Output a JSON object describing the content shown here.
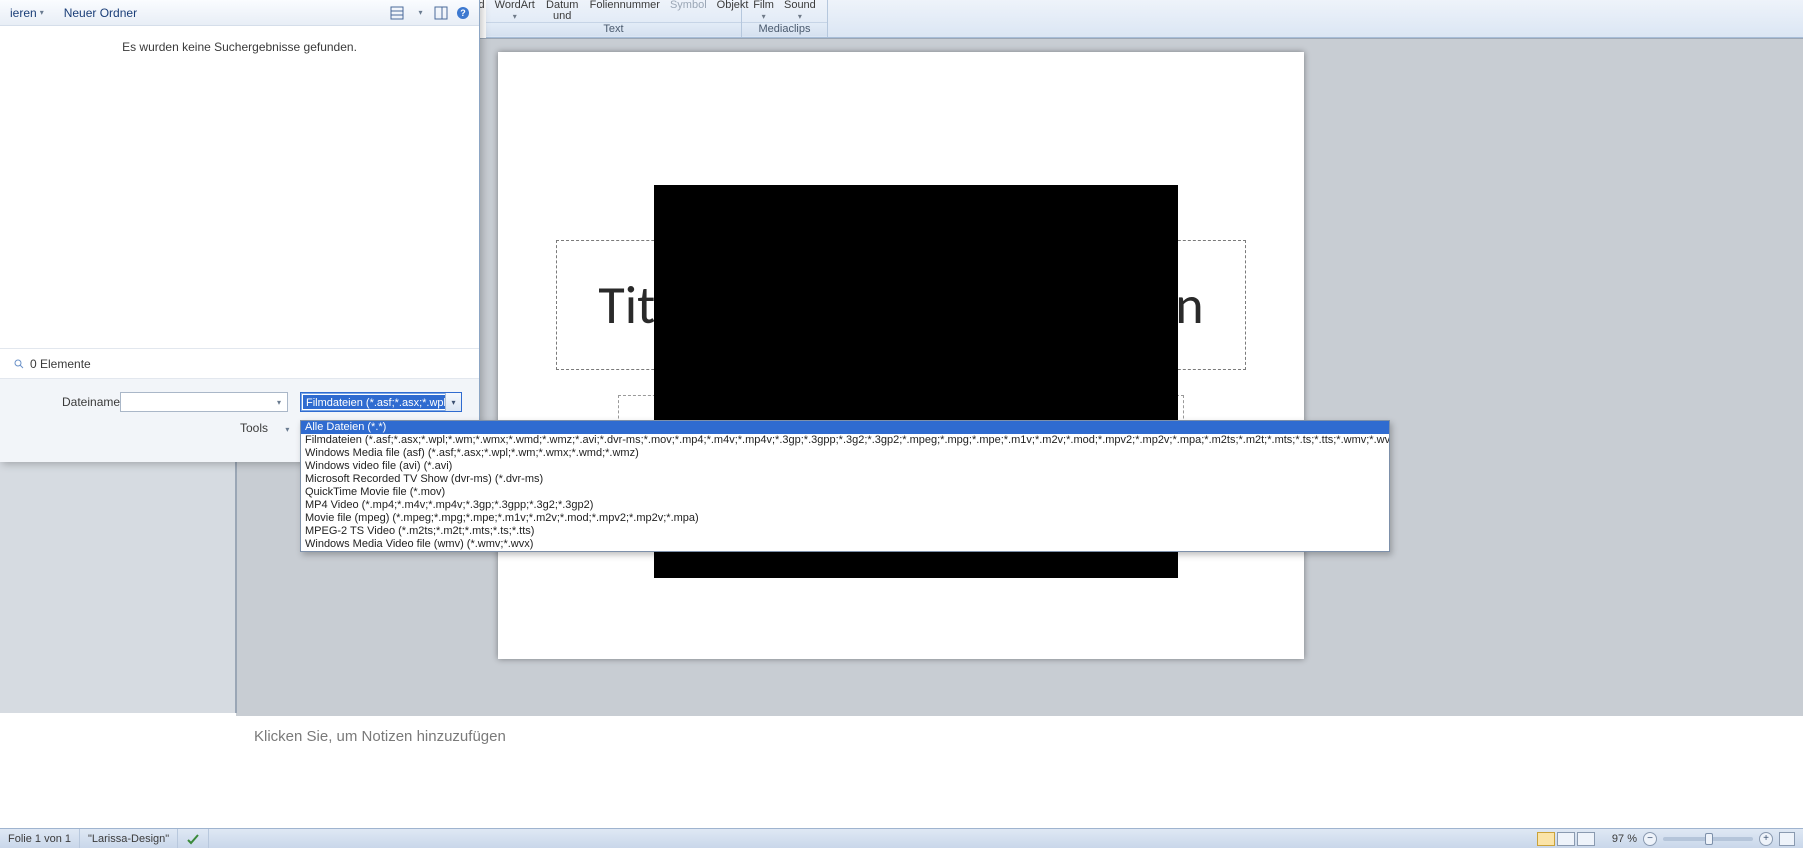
{
  "ribbon": {
    "text_group": {
      "label": "Text",
      "buttons": [
        {
          "label": "d"
        },
        {
          "label": "WordArt",
          "has_menu": true
        },
        {
          "label": "Datum und\nUhrzeit"
        },
        {
          "label": "Foliennummer"
        },
        {
          "label": "Symbol",
          "disabled": true
        },
        {
          "label": "Objekt"
        }
      ]
    },
    "clips_group": {
      "label": "Mediaclips",
      "buttons": [
        {
          "label": "Film",
          "has_menu": true
        },
        {
          "label": "Sound",
          "has_menu": true
        }
      ]
    }
  },
  "slide": {
    "title_placeholder_left": "Tit",
    "title_placeholder_right": "n"
  },
  "notes": {
    "placeholder": "Klicken Sie, um Notizen hinzuzufügen"
  },
  "statusbar": {
    "slide_info": "Folie 1 von 1",
    "theme": "\"Larissa-Design\"",
    "zoom": "97 %"
  },
  "dialog": {
    "toolbar": {
      "organize": "ieren",
      "new_folder": "Neuer Ordner"
    },
    "body_msg": "Es wurden keine Suchergebnisse gefunden.",
    "status": "0 Elemente",
    "filename_label": "Dateiname:",
    "filename_value": "",
    "filetype_selected": "Filmdateien (*.asf;*.asx;*.wpl;*.w",
    "tools": "Tools"
  },
  "filetype_options": [
    "Alle Dateien (*.*)",
    "Filmdateien (*.asf;*.asx;*.wpl;*.wm;*.wmx;*.wmd;*.wmz;*.avi;*.dvr-ms;*.mov;*.mp4;*.m4v;*.mp4v;*.3gp;*.3gpp;*.3g2;*.3gp2;*.mpeg;*.mpg;*.mpe;*.m1v;*.m2v;*.mod;*.mpv2;*.mp2v;*.mpa;*.m2ts;*.m2t;*.mts;*.ts;*.tts;*.wmv;*.wvx;*.dat;*.ivf)",
    "Windows Media file (asf) (*.asf;*.asx;*.wpl;*.wm;*.wmx;*.wmd;*.wmz)",
    "Windows video file (avi) (*.avi)",
    "Microsoft Recorded TV Show (dvr-ms) (*.dvr-ms)",
    "QuickTime Movie file (*.mov)",
    "MP4 Video (*.mp4;*.m4v;*.mp4v;*.3gp;*.3gpp;*.3g2;*.3gp2)",
    "Movie file (mpeg) (*.mpeg;*.mpg;*.mpe;*.m1v;*.m2v;*.mod;*.mpv2;*.mp2v;*.mpa)",
    "MPEG-2 TS Video (*.m2ts;*.m2t;*.mts;*.ts;*.tts)",
    "Windows Media Video file (wmv) (*.wmv;*.wvx)"
  ]
}
